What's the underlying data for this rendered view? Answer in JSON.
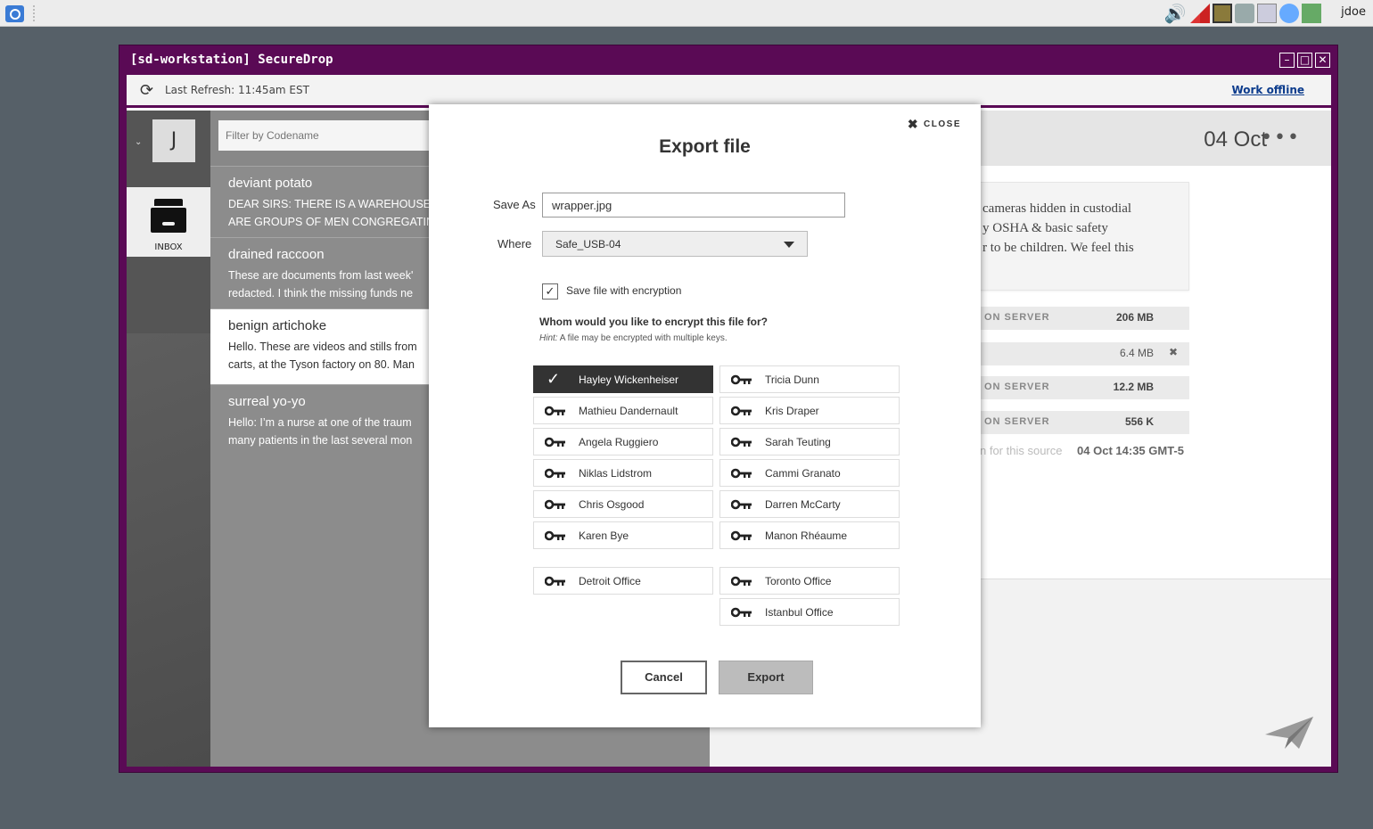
{
  "desktop": {
    "user_name": "jdoe"
  },
  "window": {
    "title": "[sd-workstation] SecureDrop"
  },
  "topbar": {
    "last_refresh": "Last Refresh: 11:45am EST",
    "work_offline": "Work offline"
  },
  "user": {
    "initial": "J"
  },
  "nav": {
    "inbox_label": "INBOX"
  },
  "filter": {
    "placeholder": "Filter by Codename"
  },
  "sources": [
    {
      "name": "deviant potato",
      "line1": "DEAR SIRS: THERE IS A WAREHOUSE G",
      "line2": "ARE GROUPS OF MEN CONGREGATIN"
    },
    {
      "name": "drained raccoon",
      "line1": "These are documents from last week'",
      "line2": "redacted. I think the missing funds ne"
    },
    {
      "name": "benign artichoke",
      "line1": "Hello. These are videos and stills from",
      "line2": "carts, at the Tyson factory on 80. Man"
    },
    {
      "name": "surreal yo-yo",
      "line1": "Hello: I’m a nurse at one of the traum",
      "line2": "many patients in the last several mon"
    }
  ],
  "conversation": {
    "date": "04 Oct",
    "message_lines": [
      "cameras hidden in custodial",
      "y OSHA & basic safety",
      "r to be children. We feel this"
    ],
    "files": [
      {
        "status": "ON SERVER",
        "size": "206 MB"
      },
      {
        "status": "",
        "size": "6.4 MB"
      },
      {
        "status": "ON SERVER",
        "size": "12.2 MB"
      },
      {
        "status": "ON SERVER",
        "size": "556 K"
      }
    ],
    "deletion_label": "n for this source",
    "deletion_time": "04 Oct 14:35 GMT-5"
  },
  "export_dialog": {
    "close_label": "CLOSE",
    "title": "Export file",
    "save_as_label": "Save As",
    "save_as_value": "wrapper.jpg",
    "where_label": "Where",
    "where_value": "Safe_USB-04",
    "encrypt_label": "Save file with encryption",
    "encrypt_checked": true,
    "whom_question": "Whom would you like to encrypt this file for?",
    "hint_prefix": "Hint:",
    "hint_text": " A file may be encrypted with multiple keys.",
    "recipients_left": [
      "Hayley Wickenheiser",
      "Mathieu Dandernault",
      "Angela Ruggiero",
      "Niklas Lidstrom",
      "Chris Osgood",
      "Karen Bye"
    ],
    "recipients_right": [
      "Tricia Dunn",
      "Kris Draper",
      "Sarah Teuting",
      "Cammi Granato",
      "Darren McCarty",
      "Manon Rhéaume"
    ],
    "offices_left": [
      "Detroit Office"
    ],
    "offices_right": [
      "Toronto Office",
      "Istanbul Office"
    ],
    "selected_recipient": "Hayley Wickenheiser",
    "cancel_label": "Cancel",
    "export_label": "Export"
  }
}
